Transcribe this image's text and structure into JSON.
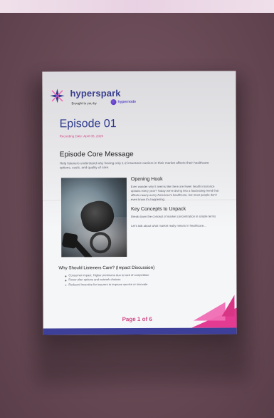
{
  "document": {
    "brand": {
      "name": "hyperspark",
      "tagline": "Brought to you by",
      "sponsor": "hypernode"
    },
    "title": "Episode 01",
    "recording_date": "Recording Date: April 05, 2025",
    "core_message": {
      "heading": "Episode Core Message",
      "body": "Help listeners understand why having only 1-2 insurance carriers in their market affects their healthcare options, costs, and quality of care."
    },
    "opening_hook": {
      "heading": "Opening Hook",
      "body": "Ever wonder why it seems like there are fewer health insurance options every year? Today we're diving into a fascinating trend that affects nearly every American's healthcare, but most people don't even know it's happening."
    },
    "key_concepts": {
      "heading": "Key Concepts to Unpack",
      "body_1": "Break down the concept of market concentration in simple terms",
      "body_2": "Let's talk about what market really means in healthcare..."
    },
    "why_care": {
      "heading": "Why Should Listeners Care? (Impact Discussion)",
      "items": [
        "Consumer impact: Higher premiums due to lack of competition",
        "Fewer plan options and network choices",
        "Reduced incentive for insurers to improve service or innovate"
      ]
    },
    "page_label": "Page 1 of 6"
  }
}
